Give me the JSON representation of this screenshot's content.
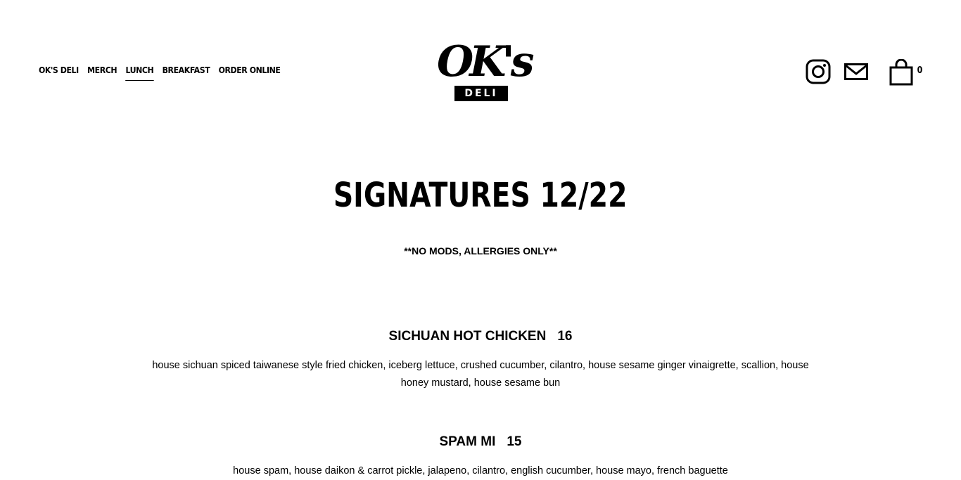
{
  "nav": {
    "items": [
      {
        "label": "OK'S DELI"
      },
      {
        "label": "MERCH"
      },
      {
        "label": "LUNCH",
        "active": true
      },
      {
        "label": "BREAKFAST"
      },
      {
        "label": "ORDER ONLINE"
      }
    ]
  },
  "logo": {
    "script": "OK's",
    "box": "DELI"
  },
  "header_icons": {
    "instagram": "instagram-icon",
    "mail": "mail-icon",
    "cart": "shopping-bag-icon",
    "cart_count": "0"
  },
  "main": {
    "title": "SIGNATURES 12/22",
    "subtitle": "**NO MODS, ALLERGIES ONLY**",
    "items": [
      {
        "name": "SICHUAN HOT CHICKEN",
        "price": "16",
        "description": "house sichuan spiced taiwanese style fried chicken, iceberg lettuce, crushed cucumber, cilantro, house sesame ginger vinaigrette, scallion, house honey mustard, house sesame bun"
      },
      {
        "name": "SPAM MI",
        "price": "15",
        "description": "house spam, house daikon & carrot pickle, jalapeno, cilantro, english cucumber, house mayo, french baguette"
      }
    ]
  },
  "colors": {
    "text": "#000000",
    "background": "#ffffff"
  }
}
